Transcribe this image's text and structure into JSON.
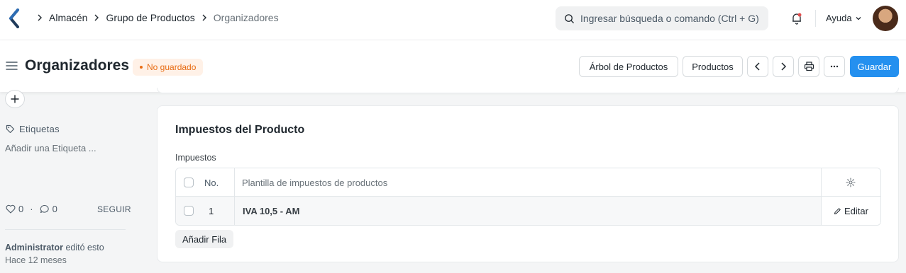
{
  "navbar": {
    "breadcrumbs": [
      {
        "label": "Almacén"
      },
      {
        "label": "Grupo de Productos"
      },
      {
        "label": "Organizadores"
      }
    ],
    "search_placeholder": "Ingresar búsqueda o comando (Ctrl + G)",
    "help_label": "Ayuda",
    "icons": {
      "logo": "frappe-logo-icon",
      "search": "search-icon",
      "notifications": "bell-icon",
      "help_caret": "chevron-down-icon"
    }
  },
  "page_head": {
    "title": "Organizadores",
    "status_badge": "No guardado",
    "status_color": "#e86c13",
    "buttons": {
      "product_tree": "Árbol de Productos",
      "products": "Productos",
      "save": "Guardar"
    },
    "accent_color": "#2490ef"
  },
  "sidebar": {
    "tags_label": "Etiquetas",
    "add_tag": "Añadir una Etiqueta ...",
    "likes_count": "0",
    "comments_count": "0",
    "follow_label": "SEGUIR",
    "edited_by": "Administrator",
    "edited_text": "editó esto",
    "edited_ago": "Hace 12 meses"
  },
  "section": {
    "title": "Impuestos del Producto",
    "field_label": "Impuestos",
    "table": {
      "columns": {
        "no": "No.",
        "template": "Plantilla de impuestos de productos"
      },
      "rows": [
        {
          "no": "1",
          "template": "IVA 10,5 - AM",
          "edit_label": "Editar"
        }
      ]
    },
    "add_row": "Añadir Fila"
  }
}
